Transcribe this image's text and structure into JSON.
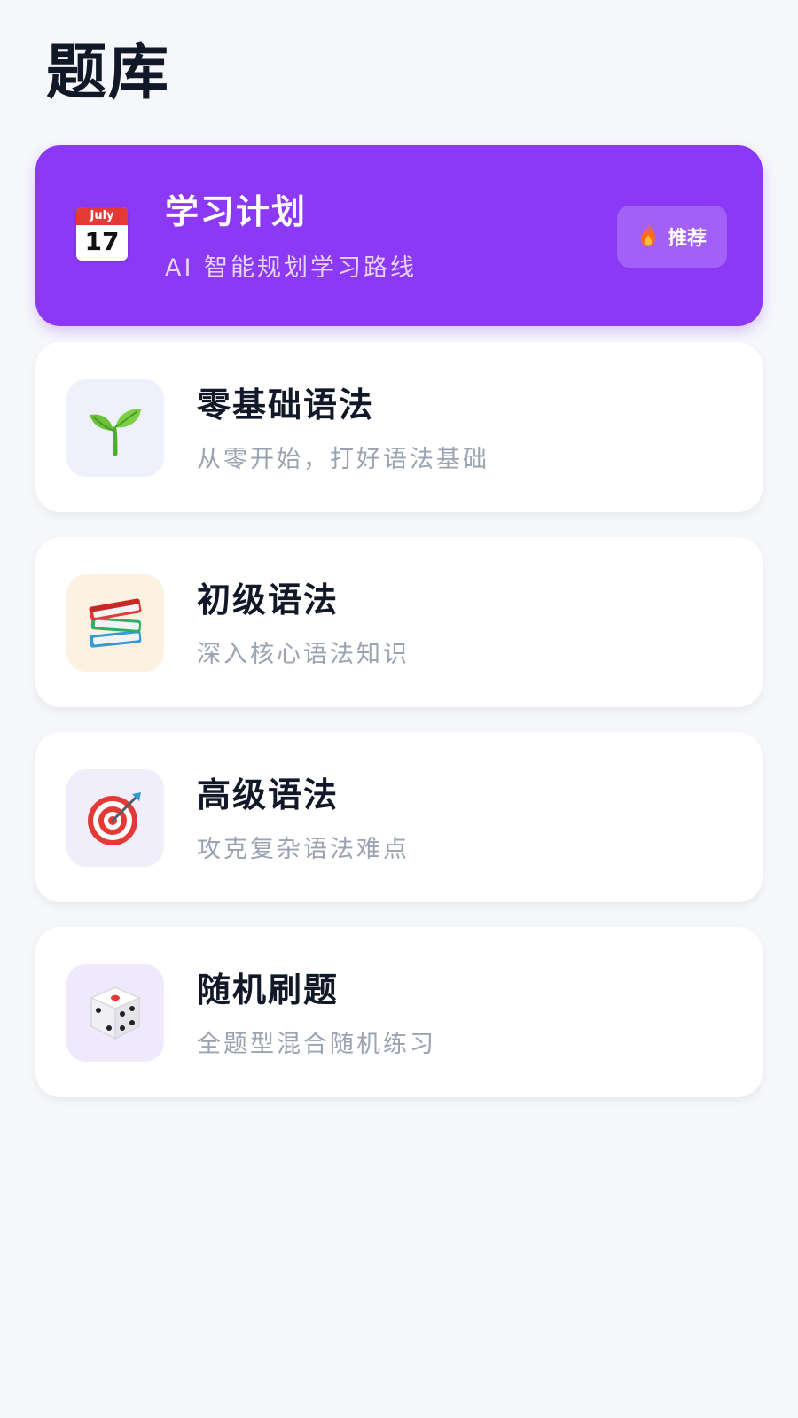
{
  "page": {
    "title": "题库"
  },
  "plan_card": {
    "title": "学习计划",
    "subtitle": "AI 智能规划学习路线",
    "calendar_month": "July",
    "calendar_day": "17",
    "badge_label": "推荐",
    "badge_icon": "fire-icon",
    "icon": "calendar-icon",
    "color": "#8b39f5"
  },
  "cards": [
    {
      "title": "零基础语法",
      "subtitle": "从零开始，打好语法基础",
      "icon": "seedling-icon",
      "icon_bg": "#eef0fb"
    },
    {
      "title": "初级语法",
      "subtitle": "深入核心语法知识",
      "icon": "books-icon",
      "icon_bg": "#fdf1e1"
    },
    {
      "title": "高级语法",
      "subtitle": "攻克复杂语法难点",
      "icon": "target-icon",
      "icon_bg": "#f1eefb"
    },
    {
      "title": "随机刷题",
      "subtitle": "全题型混合随机练习",
      "icon": "dice-icon",
      "icon_bg": "#efe9fb"
    }
  ]
}
